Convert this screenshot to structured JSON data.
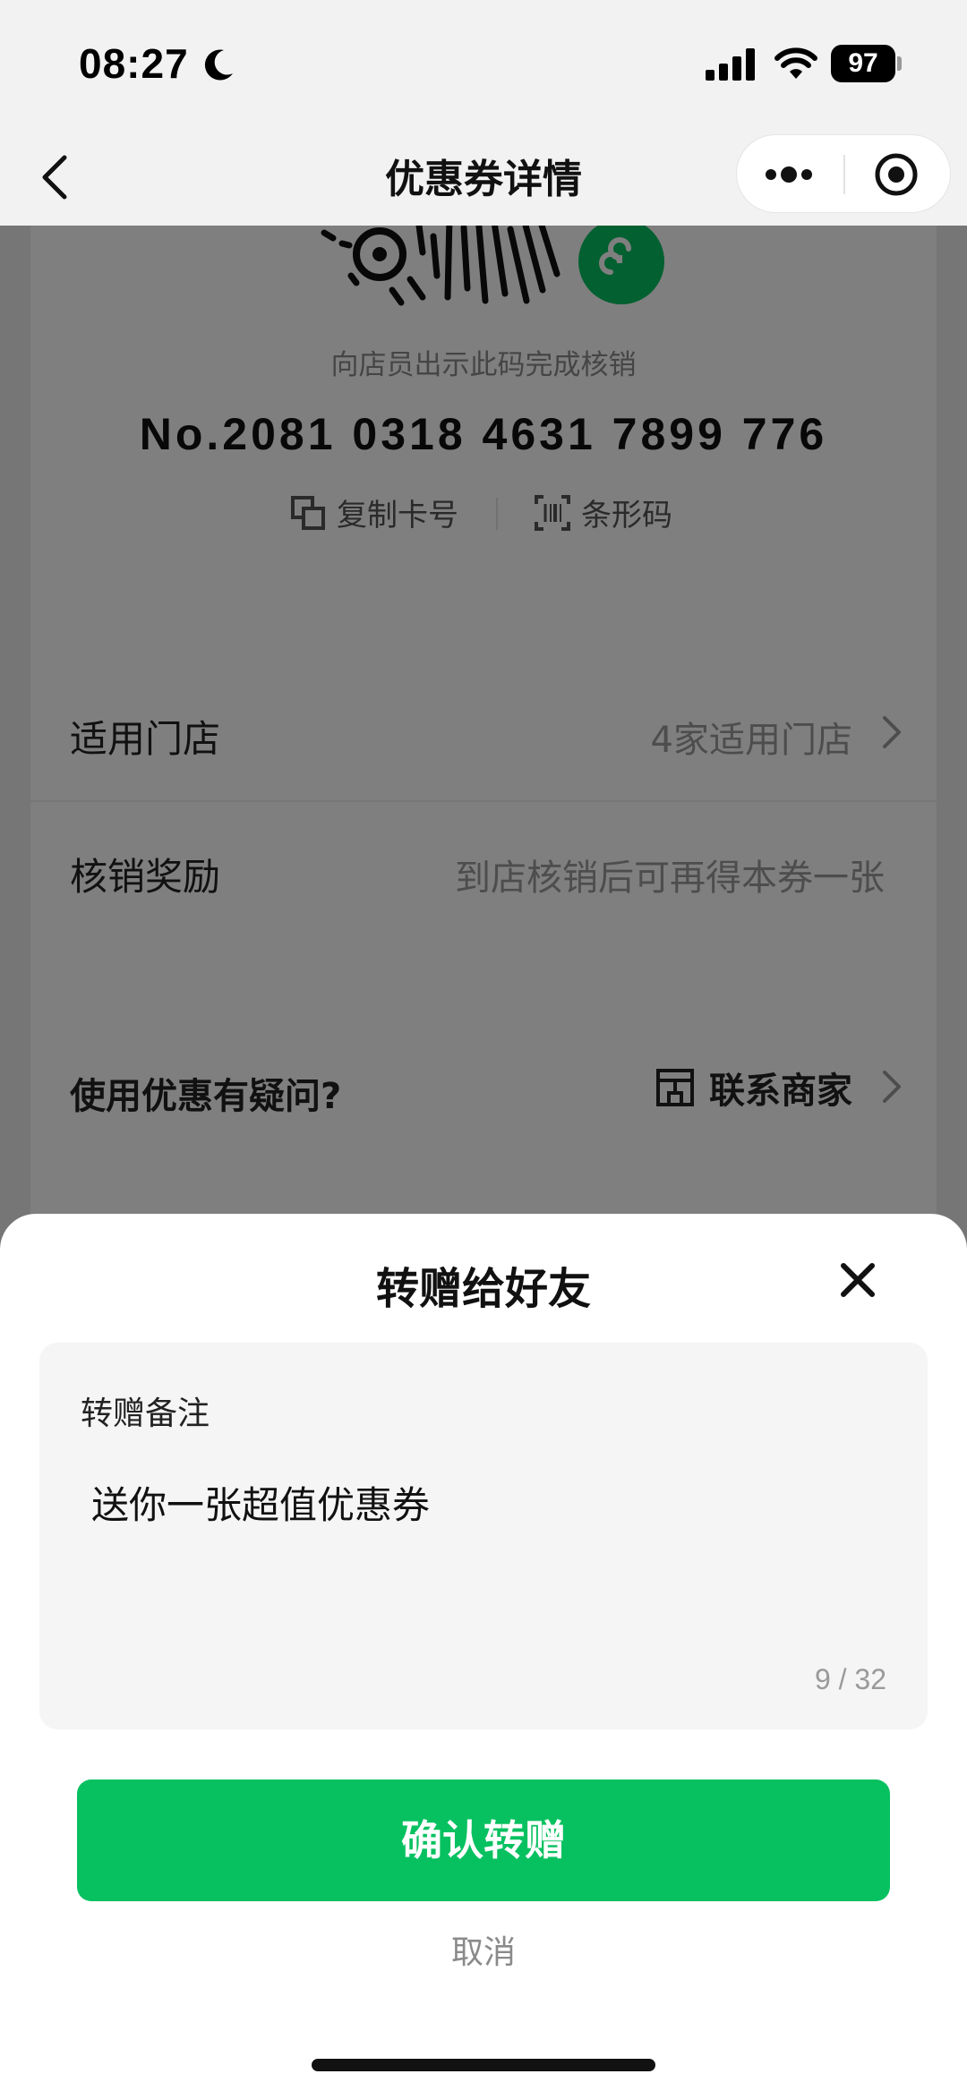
{
  "status_bar": {
    "time": "08:27",
    "battery": "97"
  },
  "nav": {
    "title": "优惠券详情"
  },
  "coupon": {
    "qr_hint": "向店员出示此码完成核销",
    "number": "No.2081 0318 4631 7899 776",
    "copy_label": "复制卡号",
    "barcode_label": "条形码"
  },
  "info_rows": [
    {
      "label": "适用门店",
      "value": "4家适用门店"
    },
    {
      "label": "核销奖励",
      "value": "到店核销后可再得本券一张"
    }
  ],
  "help": {
    "question": "使用优惠有疑问?",
    "contact_label": "联系商家"
  },
  "sheet": {
    "title": "转赠给好友",
    "note_label": "转赠备注",
    "note_value": "送你一张超值优惠券",
    "note_count": "9 / 32",
    "confirm_label": "确认转赠",
    "cancel_label": "取消"
  },
  "colors": {
    "brand_green": "#07c160",
    "overlay": "rgba(0,0,0,0.5)"
  }
}
